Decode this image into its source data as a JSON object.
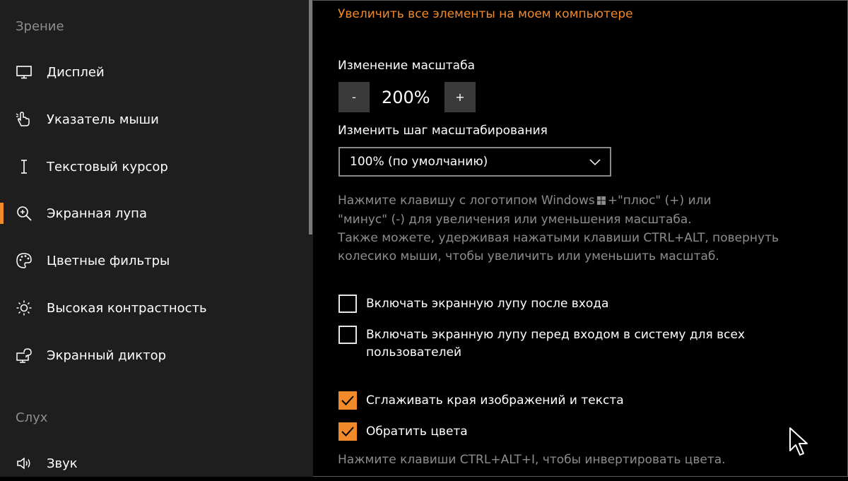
{
  "sidebar": {
    "section_vision": "Зрение",
    "section_hearing": "Слух",
    "items": [
      {
        "label": "Дисплей",
        "icon": "monitor-icon"
      },
      {
        "label": "Указатель мыши",
        "icon": "pointer-hand-icon"
      },
      {
        "label": "Текстовый курсор",
        "icon": "text-cursor-icon"
      },
      {
        "label": "Экранная лупа",
        "icon": "magnifier-icon",
        "active": true
      },
      {
        "label": "Цветные фильтры",
        "icon": "palette-icon"
      },
      {
        "label": "Высокая контрастность",
        "icon": "sun-icon"
      },
      {
        "label": "Экранный диктор",
        "icon": "narrator-icon"
      },
      {
        "label": "Звук",
        "icon": "speaker-icon"
      }
    ]
  },
  "main": {
    "link_text": "Увеличить все элементы на моем компьютере",
    "zoom_heading": "Изменение масштаба",
    "zoom_minus": "-",
    "zoom_value": "200%",
    "zoom_plus": "+",
    "step_heading": "Изменить шаг масштабирования",
    "step_selected": "100% (по умолчанию)",
    "help_text": {
      "line1_before_logo": "Нажмите клавишу с логотипом Windows",
      "line1_after_logo": "+\"плюс\" (+) или",
      "line2": "\"минус\" (-) для увеличения или уменьшения масштаба.",
      "line3": "Также можете, удерживая нажатыми клавиши CTRL+ALT, повернуть",
      "line4": "колесико мыши, чтобы увеличить или уменьшить масштаб."
    },
    "checkboxes": [
      {
        "label": "Включать экранную лупу после входа",
        "checked": false
      },
      {
        "label": "Включать экранную лупу перед входом в систему для всех пользователей",
        "checked": false
      },
      {
        "label": "Сглаживать края изображений и текста",
        "checked": true
      },
      {
        "label": "Обратить цвета",
        "checked": true
      }
    ],
    "invert_hint": "Нажмите клавиши CTRL+ALT+I, чтобы инвертировать цвета."
  },
  "colors": {
    "accent": "#f08a2b",
    "sidebar_bg": "#1e1e1e",
    "main_bg": "#000000",
    "muted_text": "#8d8d8d"
  }
}
